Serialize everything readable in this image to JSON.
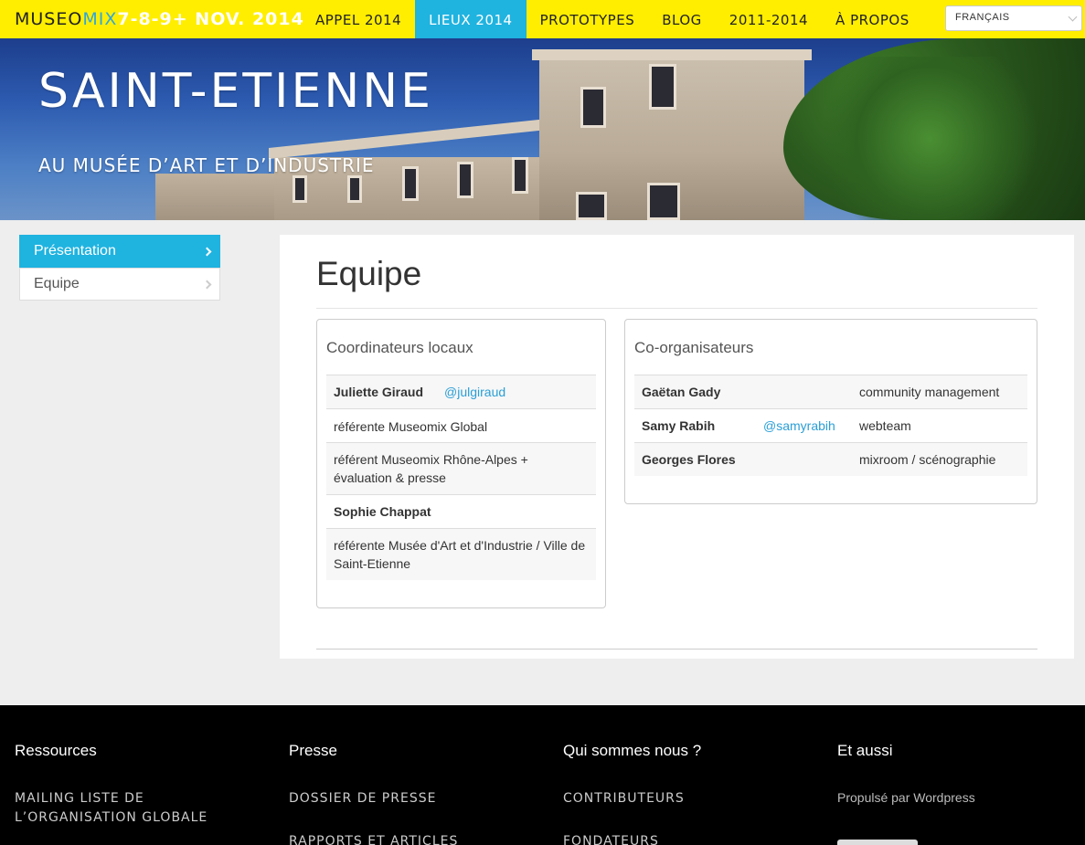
{
  "header": {
    "logo_part1": "MUSEO",
    "logo_part2": "MIX",
    "logo_dates": "7-8-9+ NOV. 2014",
    "nav": [
      "APPEL 2014",
      "LIEUX 2014",
      "PROTOTYPES",
      "BLOG",
      "2011-2014",
      "À PROPOS"
    ],
    "active_nav": "LIEUX 2014",
    "language_select": "FRANÇAIS"
  },
  "hero": {
    "title": "SAINT-ETIENNE",
    "subtitle": "AU MUSÉE D’ART ET D’INDUSTRIE"
  },
  "sidebar": {
    "items": [
      {
        "label": "Présentation",
        "active": true
      },
      {
        "label": "Equipe",
        "active": false
      }
    ]
  },
  "main": {
    "title": "Equipe",
    "coordinators": {
      "title": "Coordinateurs locaux",
      "rows": [
        {
          "name": "Juliette Giraud",
          "handle": "@julgiraud"
        },
        {
          "text": "référente Museomix Global"
        },
        {
          "text": "référent Museomix Rhône-Alpes + évaluation & presse"
        },
        {
          "name": "Sophie Chappat",
          "handle": ""
        },
        {
          "text": "référente Musée d'Art et d'Industrie / Ville de Saint-Etienne"
        }
      ]
    },
    "coorganizers": {
      "title": "Co-organisateurs",
      "rows": [
        {
          "name": "Gaëtan Gady",
          "handle": "",
          "role": "community management"
        },
        {
          "name": "Samy Rabih",
          "handle": "@samyrabih",
          "role": "webteam"
        },
        {
          "name": "Georges Flores",
          "handle": "",
          "role": "mixroom / scénographie"
        }
      ]
    }
  },
  "footer": {
    "columns": [
      {
        "heading": "Ressources",
        "links": [
          "MAILING LISTE DE L’ORGANISATION GLOBALE"
        ]
      },
      {
        "heading": "Presse",
        "links": [
          "DOSSIER DE PRESSE",
          "RAPPORTS ET ARTICLES"
        ]
      },
      {
        "heading": "Qui sommes nous ?",
        "links": [
          "CONTRIBUTEURS",
          "FONDATEURS"
        ]
      },
      {
        "heading": "Et aussi",
        "text": "Propulsé par Wordpress"
      }
    ]
  },
  "colors": {
    "brand_yellow": "#ffee00",
    "accent_blue": "#1fb3e0",
    "link_blue": "#2a9fd6"
  }
}
